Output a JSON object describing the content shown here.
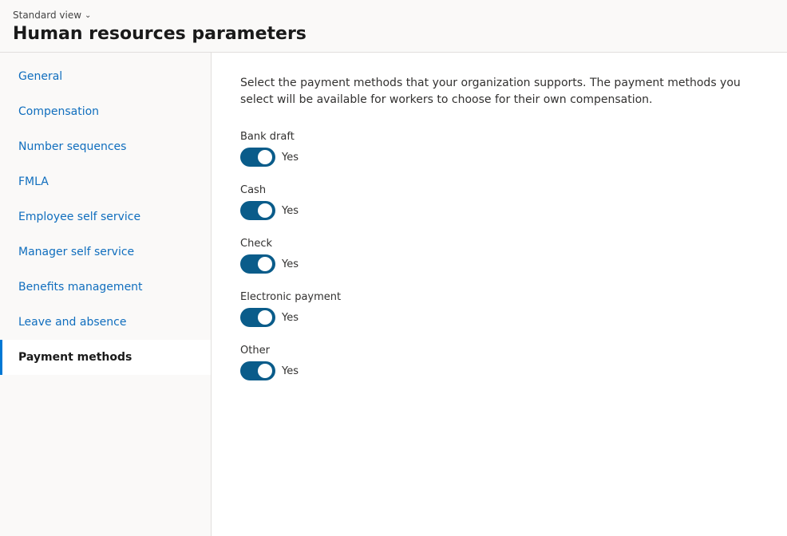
{
  "header": {
    "standard_view_label": "Standard view",
    "page_title": "Human resources parameters"
  },
  "sidebar": {
    "items": [
      {
        "id": "general",
        "label": "General",
        "active": false
      },
      {
        "id": "compensation",
        "label": "Compensation",
        "active": false
      },
      {
        "id": "number-sequences",
        "label": "Number sequences",
        "active": false
      },
      {
        "id": "fmla",
        "label": "FMLA",
        "active": false
      },
      {
        "id": "employee-self-service",
        "label": "Employee self service",
        "active": false
      },
      {
        "id": "manager-self-service",
        "label": "Manager self service",
        "active": false
      },
      {
        "id": "benefits-management",
        "label": "Benefits management",
        "active": false
      },
      {
        "id": "leave-and-absence",
        "label": "Leave and absence",
        "active": false
      },
      {
        "id": "payment-methods",
        "label": "Payment methods",
        "active": true
      }
    ]
  },
  "main": {
    "description": "Select the payment methods that your organization supports. The payment methods you select will be available for workers to choose for their own compensation.",
    "payment_methods": [
      {
        "id": "bank-draft",
        "label": "Bank draft",
        "enabled": true,
        "toggle_label": "Yes"
      },
      {
        "id": "cash",
        "label": "Cash",
        "enabled": true,
        "toggle_label": "Yes"
      },
      {
        "id": "check",
        "label": "Check",
        "enabled": true,
        "toggle_label": "Yes"
      },
      {
        "id": "electronic-payment",
        "label": "Electronic payment",
        "enabled": true,
        "toggle_label": "Yes"
      },
      {
        "id": "other",
        "label": "Other",
        "enabled": true,
        "toggle_label": "Yes"
      }
    ]
  }
}
